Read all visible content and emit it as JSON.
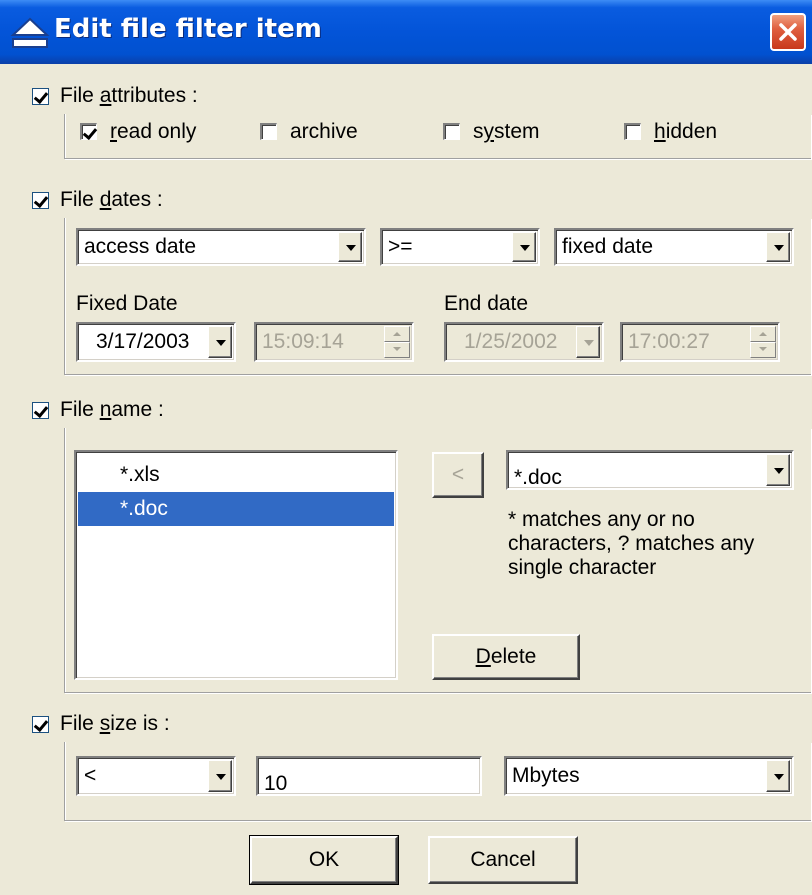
{
  "window": {
    "title": "Edit file filter item",
    "close_glyph": "✕"
  },
  "attributes": {
    "enabled": true,
    "label_pre": "File ",
    "label_key": "a",
    "label_post": "ttributes :",
    "items": [
      {
        "key": "r",
        "rest": "ead only",
        "checked": true
      },
      {
        "pre": "",
        "key": "",
        "rest": "archive",
        "checked": false
      },
      {
        "pre": "s",
        "key": "y",
        "rest": "stem",
        "checked": false
      },
      {
        "key": "h",
        "rest": "idden",
        "checked": false
      }
    ]
  },
  "dates": {
    "enabled": true,
    "label_pre": "File ",
    "label_key": "d",
    "label_post": "ates :",
    "date_type": "access date",
    "operator": ">=",
    "mode": "fixed date",
    "fixed_date_label": "Fixed Date",
    "end_date_label": "End date",
    "fixed_date": "3/17/2003",
    "fixed_time": "15:09:14",
    "end_date": "1/25/2002",
    "end_time": "17:00:27"
  },
  "name": {
    "enabled": true,
    "label_pre": "File ",
    "label_key": "n",
    "label_post": "ame :",
    "patterns": [
      "*.xls",
      "*.doc"
    ],
    "selected_index": 1,
    "add_button": "<",
    "pattern_value": "*.doc",
    "hint": "* matches any or no characters, ? matches any single character",
    "delete_key": "D",
    "delete_rest": "elete"
  },
  "size": {
    "enabled": true,
    "label_pre": "File ",
    "label_key": "s",
    "label_post": "ize is :",
    "operator": "<",
    "value": "10",
    "unit": "Mbytes"
  },
  "buttons": {
    "ok": "OK",
    "cancel": "Cancel"
  }
}
